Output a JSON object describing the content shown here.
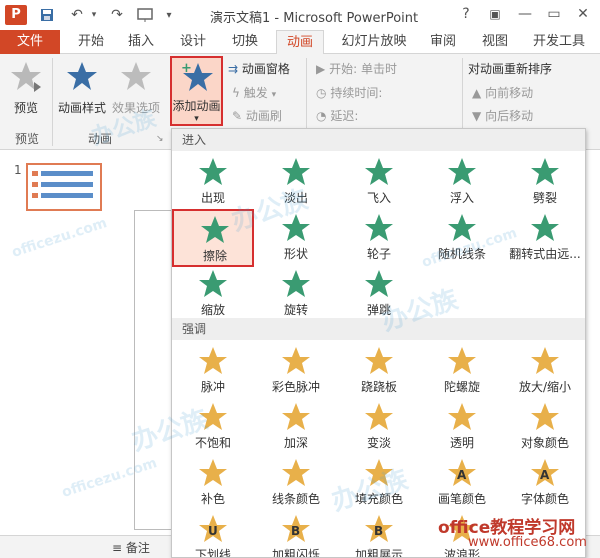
{
  "window": {
    "title": "演示文稿1 - Microsoft PowerPoint",
    "app_logo": "P",
    "help": "?",
    "ribbon_opts": "▣",
    "minimize": "—",
    "restore": "▭",
    "close": "✕"
  },
  "tabs": [
    "文件",
    "开始",
    "插入",
    "设计",
    "切换",
    "动画",
    "幻灯片放映",
    "审阅",
    "视图",
    "开发工具"
  ],
  "active_tab": "动画",
  "ribbon": {
    "preview_label": "预览",
    "style_label": "动画样式",
    "effect_label": "效果选项",
    "add_anim_label": "添加动画",
    "anim_pane": "动画窗格",
    "trigger": "触发",
    "anim_painter": "动画刷",
    "start_label": "开始:",
    "start_value": "单击时",
    "duration_label": "持续时间:",
    "delay_label": "延迟:",
    "reorder_title": "对动画重新排序",
    "move_earlier": "向前移动",
    "move_later": "向后移动",
    "group_preview": "预览",
    "group_animation": "动画"
  },
  "gallery": {
    "section_entrance": "进入",
    "entrance": [
      "出现",
      "淡出",
      "飞入",
      "浮入",
      "劈裂",
      "擦除",
      "形状",
      "轮子",
      "随机线条",
      "翻转式由远...",
      "缩放",
      "旋转",
      "弹跳"
    ],
    "section_emphasis": "强调",
    "emphasis": [
      "脉冲",
      "彩色脉冲",
      "跷跷板",
      "陀螺旋",
      "放大/缩小",
      "不饱和",
      "加深",
      "变淡",
      "透明",
      "对象颜色",
      "补色",
      "线条颜色",
      "填充颜色",
      "画笔颜色",
      "字体颜色",
      "下划线",
      "加粗闪烁",
      "加粗展示",
      "波浪形"
    ],
    "selected": "擦除"
  },
  "slides": {
    "number": "1"
  },
  "status": {
    "notes": "备注"
  },
  "watermark": {
    "logo": "办公族",
    "url": "officezu.com",
    "brand": "office教程学习网",
    "brand_url": "www.office68.com"
  },
  "colors": {
    "accent": "#d24726",
    "entrance_green": "#3a9b72",
    "emphasis_gold": "#e8b04a"
  }
}
